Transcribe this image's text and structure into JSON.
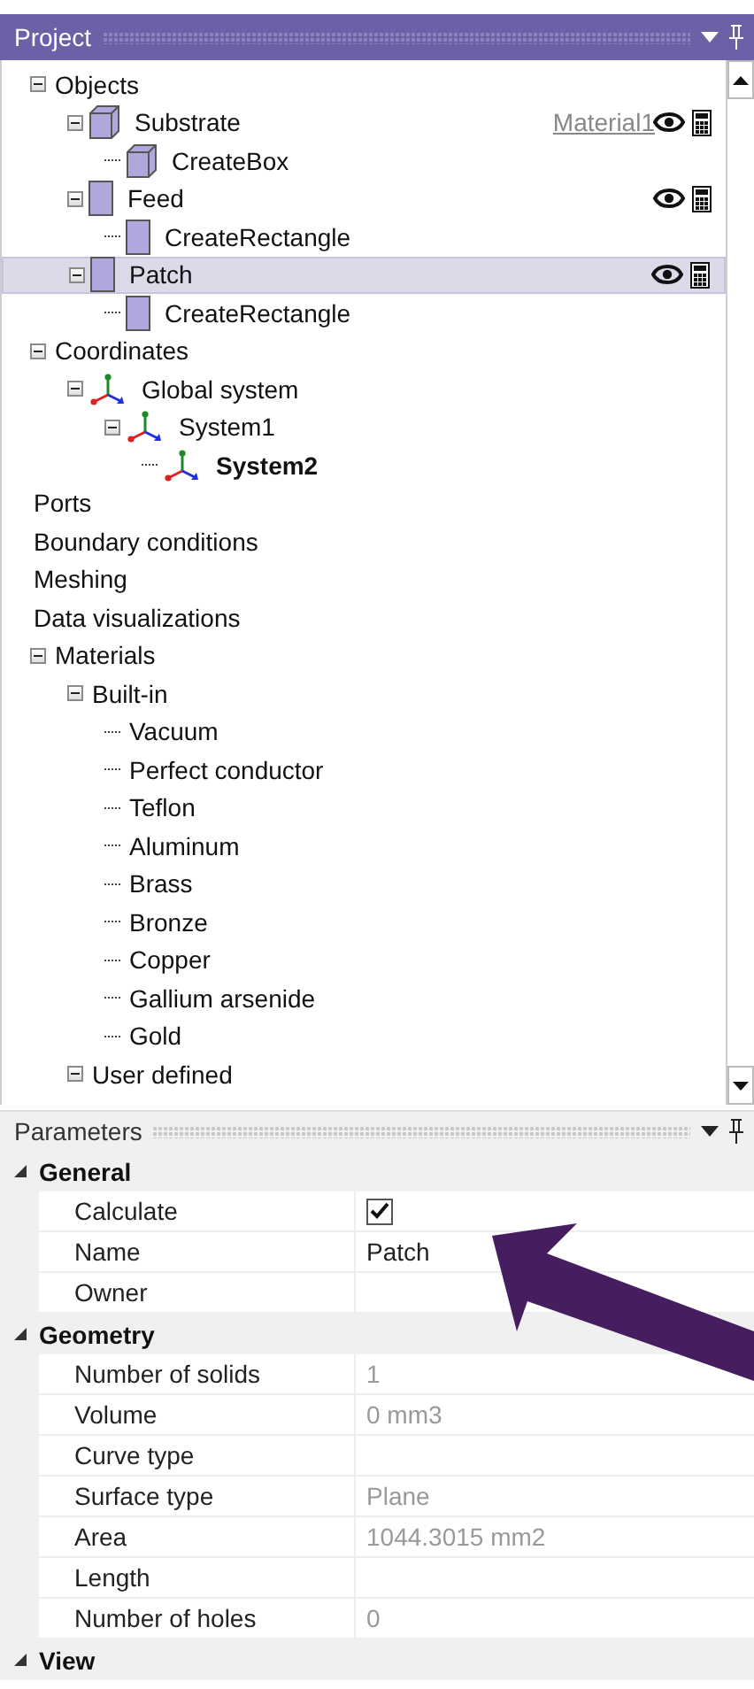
{
  "project_panel": {
    "title": "Project",
    "tree": [
      {
        "label": "Objects",
        "expanded": true,
        "children": [
          {
            "label": "Substrate",
            "kind": "box",
            "expanded": true,
            "selected": false,
            "material": "Material1",
            "tools": true,
            "children": [
              {
                "label": "CreateBox",
                "kind": "box"
              }
            ]
          },
          {
            "label": "Feed",
            "kind": "rect",
            "expanded": true,
            "selected": false,
            "tools": true,
            "children": [
              {
                "label": "CreateRectangle",
                "kind": "rect"
              }
            ]
          },
          {
            "label": "Patch",
            "kind": "rect",
            "expanded": true,
            "selected": true,
            "tools": true,
            "children": [
              {
                "label": "CreateRectangle",
                "kind": "rect"
              }
            ]
          }
        ]
      },
      {
        "label": "Coordinates",
        "expanded": true,
        "children": [
          {
            "label": "Global system",
            "kind": "axes",
            "expanded": true,
            "children": [
              {
                "label": "System1",
                "kind": "axes",
                "expanded": true,
                "children": [
                  {
                    "label": "System2",
                    "kind": "axes",
                    "active": true
                  }
                ]
              }
            ]
          }
        ]
      },
      {
        "label": "Ports"
      },
      {
        "label": "Boundary conditions"
      },
      {
        "label": "Meshing"
      },
      {
        "label": "Data visualizations"
      },
      {
        "label": "Materials",
        "expanded": true,
        "children": [
          {
            "label": "Built-in",
            "expanded": true,
            "children": [
              {
                "label": "Vacuum"
              },
              {
                "label": "Perfect conductor"
              },
              {
                "label": "Teflon"
              },
              {
                "label": "Aluminum"
              },
              {
                "label": "Brass"
              },
              {
                "label": "Bronze"
              },
              {
                "label": "Copper"
              },
              {
                "label": "Gallium arsenide"
              },
              {
                "label": "Gold"
              }
            ]
          },
          {
            "label": "User defined",
            "expanded": true
          }
        ]
      }
    ]
  },
  "parameters_panel": {
    "title": "Parameters",
    "categories": [
      {
        "label": "General",
        "expanded": true,
        "rows": [
          {
            "label": "Calculate",
            "kind": "checkbox",
            "checked": true
          },
          {
            "label": "Name",
            "kind": "text",
            "value": "Patch",
            "readonly": false
          },
          {
            "label": "Owner",
            "kind": "text"
          }
        ]
      },
      {
        "label": "Geometry",
        "expanded": true,
        "rows": [
          {
            "label": "Number of solids",
            "kind": "text",
            "value": "1",
            "readonly": true
          },
          {
            "label": "Volume",
            "kind": "text",
            "value": "0 mm3",
            "readonly": true
          },
          {
            "label": "Curve type",
            "kind": "text"
          },
          {
            "label": "Surface type",
            "kind": "text",
            "value": "Plane",
            "readonly": true
          },
          {
            "label": "Area",
            "kind": "text",
            "value": "1044.3015 mm2",
            "readonly": true
          },
          {
            "label": "Length",
            "kind": "text"
          },
          {
            "label": "Number of holes",
            "kind": "text",
            "value": "0",
            "readonly": true
          }
        ]
      },
      {
        "label": "View",
        "expanded": true
      }
    ]
  }
}
